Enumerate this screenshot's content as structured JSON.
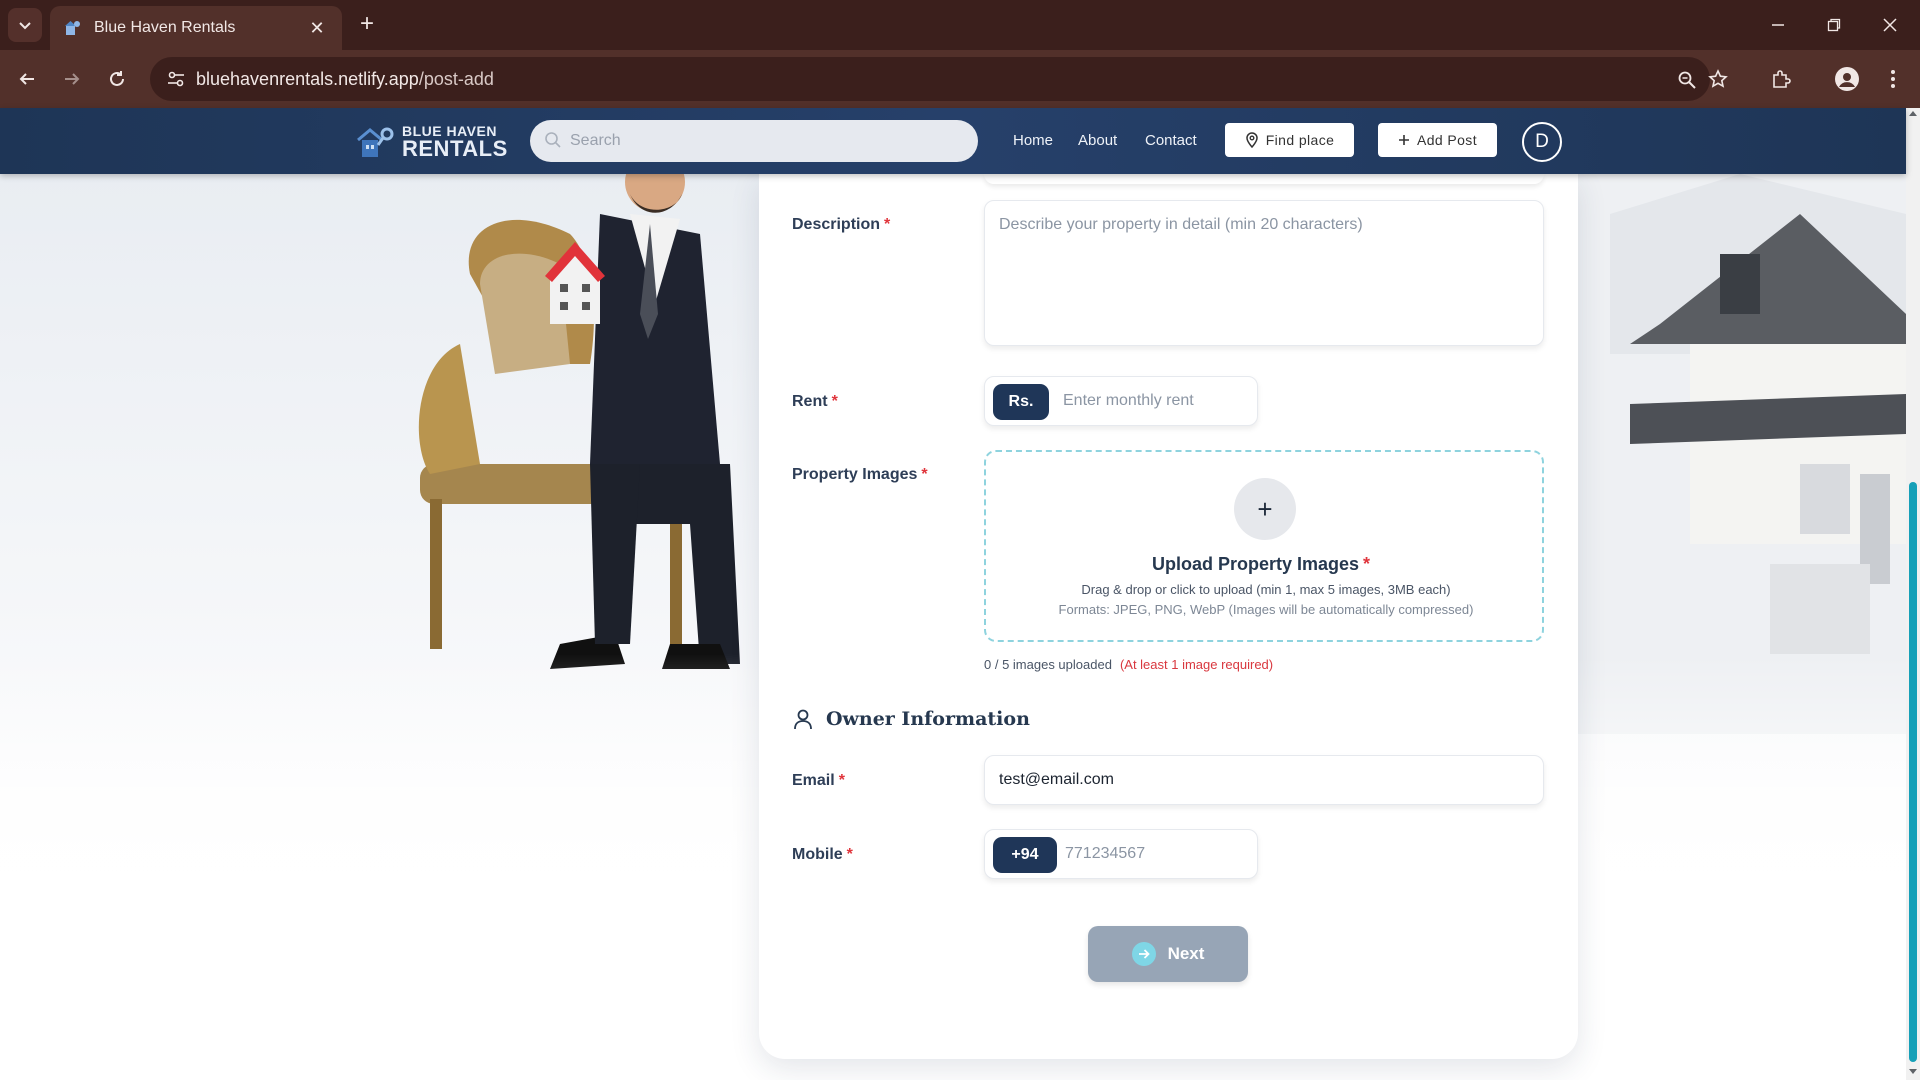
{
  "browser": {
    "tab_title": "Blue Haven Rentals",
    "url_host": "bluehavenrentals.netlify.app",
    "url_path": "/post-add"
  },
  "site": {
    "brand_line1": "BLUE HAVEN",
    "brand_line2": "RENTALS",
    "search_placeholder": "Search",
    "nav": {
      "home": "Home",
      "about": "About",
      "contact": "Contact"
    },
    "find_place": "Find place",
    "add_post": "Add Post",
    "avatar_initial": "D"
  },
  "form": {
    "description": {
      "label": "Description",
      "required_mark": "*",
      "placeholder": "Describe your property in detail (min 20 characters)"
    },
    "rent": {
      "label": "Rent",
      "required_mark": "*",
      "prefix": "Rs.",
      "placeholder": "Enter monthly rent"
    },
    "images": {
      "label": "Property Images",
      "required_mark": "*",
      "upload_title": "Upload Property Images",
      "upload_hint": "Drag & drop or click to upload (min 1, max 5 images, 3MB each)",
      "formats_hint": "Formats: JPEG, PNG, WebP (Images will be automatically compressed)",
      "status": "0 / 5 images uploaded",
      "warning": "(At least 1 image required)"
    },
    "owner_section_title": "Owner Information",
    "email": {
      "label": "Email",
      "required_mark": "*",
      "value": "test@email.com"
    },
    "mobile": {
      "label": "Mobile",
      "required_mark": "*",
      "prefix": "+94",
      "placeholder": "771234567"
    },
    "next_label": "Next"
  },
  "colors": {
    "browser_frame": "#3b1f1c",
    "header_navy": "#1e3556",
    "accent_teal": "#16a0b8",
    "required_red": "#e0353c",
    "button_disabled": "#97a5b6"
  }
}
